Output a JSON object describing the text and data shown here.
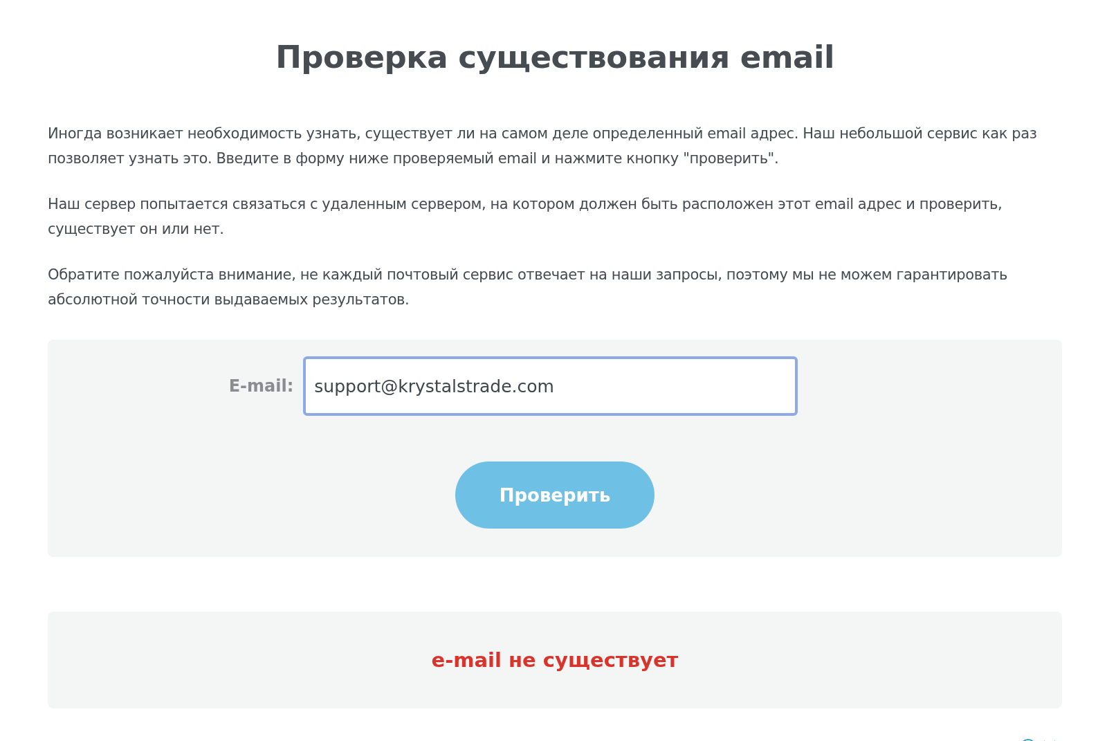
{
  "title": "Проверка существования email",
  "paragraphs": [
    "Иногда возникает необходимость узнать, существует ли на самом деле определенный email адрес. Наш небольшой сервис как раз позволяет узнать это. Введите в форму ниже проверяемый email и нажмите кнопку \"проверить\".",
    "Наш сервер попытается связаться с удаленным сервером, на котором должен быть расположен этот email адрес и проверить, существует он или нет.",
    "Обратите пожалуйста внимание, не каждый почтовый сервис отвечает на наши запросы, поэтому мы не можем гарантировать абсолютной точности выдаваемых результатов."
  ],
  "form": {
    "label": "E-mail:",
    "value": "support@krystalstrade.com",
    "focused": true,
    "button": "Проверить"
  },
  "result": {
    "text": "e-mail не существует",
    "exists": false
  }
}
